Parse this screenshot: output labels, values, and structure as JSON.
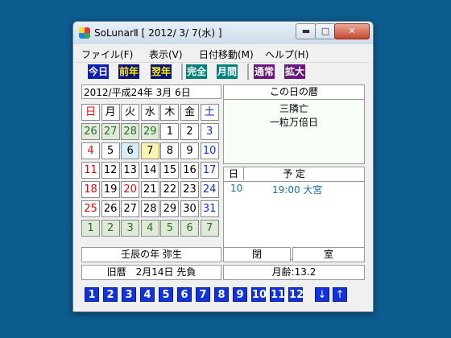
{
  "window": {
    "title": "SoLunarⅡ [ 2012/ 3/ 7(水) ]",
    "minimize_glyph": "▬",
    "maximize_glyph": "□",
    "close_glyph": "✕"
  },
  "menu": {
    "file": "ファイル(F)",
    "view": "表示(V)",
    "date_move": "日付移動(M)",
    "help": "ヘルプ(H)"
  },
  "toolbar": {
    "today": "今日",
    "prev_year": "前年",
    "next_year": "翌年",
    "full": "完全",
    "monthly": "月間",
    "normal": "通常",
    "enlarge": "拡大"
  },
  "date_display": "2012/平成24年 3月 6日",
  "weekday_headers": [
    "日",
    "月",
    "火",
    "水",
    "木",
    "金",
    "土"
  ],
  "calendar_rows": [
    [
      "26",
      "27",
      "28",
      "29",
      "1",
      "2",
      "3"
    ],
    [
      "4",
      "5",
      "6",
      "7",
      "8",
      "9",
      "10"
    ],
    [
      "11",
      "12",
      "13",
      "14",
      "15",
      "16",
      "17"
    ],
    [
      "18",
      "19",
      "20",
      "21",
      "22",
      "23",
      "24"
    ],
    [
      "25",
      "26",
      "27",
      "28",
      "29",
      "30",
      "31"
    ],
    [
      "1",
      "2",
      "3",
      "4",
      "5",
      "6",
      "7"
    ]
  ],
  "day_info": {
    "header": "この日の暦",
    "line1": "三隣亡",
    "line2": "一粒万倍日"
  },
  "schedule": {
    "day_header": "日",
    "plan_header": "予 定",
    "entry_day": "10",
    "entry_text": "19:00 大宮"
  },
  "bottom": {
    "year_info": "壬辰の年 弥生",
    "kanji1": "閉",
    "kanji2": "室",
    "lunar_date": "旧暦　2月14日 先負",
    "moon_age": "月齢:13.2"
  },
  "month_buttons": [
    "1",
    "2",
    "3",
    "4",
    "5",
    "6",
    "7",
    "8",
    "9",
    "10",
    "11",
    "12"
  ],
  "arrows": {
    "down": "↓",
    "up": "↑"
  },
  "colors": {
    "desktop": "#0d5c8f",
    "sunday": "#d01010",
    "saturday": "#1030d0",
    "month_button": "#1133dd",
    "other_month_bg": "#dfead7"
  }
}
